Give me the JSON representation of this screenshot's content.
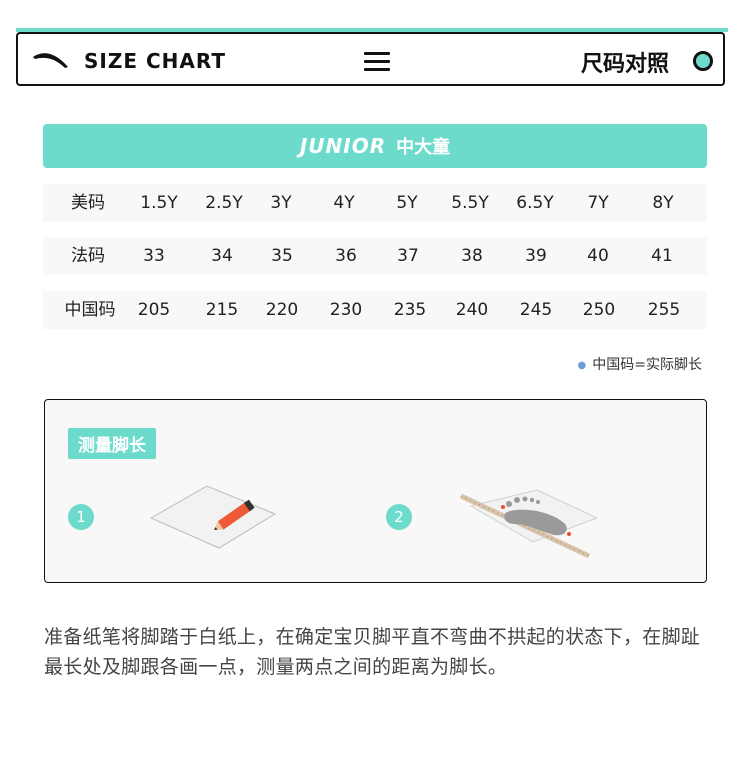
{
  "header": {
    "title": "SIZE CHART",
    "right_label": "尺码对照",
    "logo_icon": "anta-logo-icon",
    "menu_icon": "hamburger-menu-icon",
    "accent_color": "#6ddbcc"
  },
  "banner": {
    "en": "JUNIOR",
    "zh": "中大童"
  },
  "table": {
    "rows": [
      {
        "label": "美码",
        "values": [
          "1.5Y",
          "2.5Y",
          "3Y",
          "4Y",
          "5Y",
          "5.5Y",
          "6.5Y",
          "7Y",
          "8Y"
        ]
      },
      {
        "label": "法码",
        "values": [
          "33",
          "34",
          "35",
          "36",
          "37",
          "38",
          "39",
          "40",
          "41"
        ]
      },
      {
        "label": "中国码",
        "values": [
          "205",
          "215",
          "220",
          "230",
          "235",
          "240",
          "245",
          "250",
          "255"
        ]
      }
    ]
  },
  "note": "中国码=实际脚长",
  "measure": {
    "tag": "测量脚长",
    "steps": [
      "1",
      "2"
    ]
  },
  "description": "准备纸笔将脚踏于白纸上，在确定宝贝脚平直不弯曲不拱起的状态下，在脚趾最长处及脚跟各画一点，测量两点之间的距离为脚长。"
}
